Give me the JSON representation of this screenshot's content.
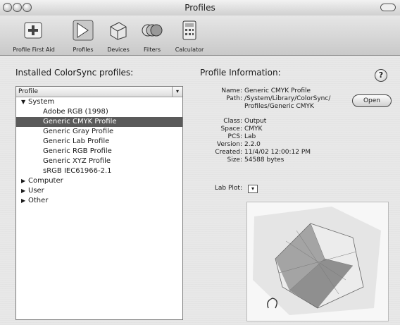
{
  "window": {
    "title": "Profiles"
  },
  "toolbar": {
    "items": [
      {
        "label": "Profile First Aid",
        "icon": "first-aid-icon"
      },
      {
        "label": "Profiles",
        "icon": "profiles-icon"
      },
      {
        "label": "Devices",
        "icon": "devices-icon"
      },
      {
        "label": "Filters",
        "icon": "filters-icon"
      },
      {
        "label": "Calculator",
        "icon": "calculator-icon"
      }
    ]
  },
  "left": {
    "label": "Installed ColorSync profiles:",
    "column_header": "Profile",
    "rows": [
      {
        "text": "System",
        "level": 0,
        "expanded": true
      },
      {
        "text": "Adobe RGB (1998)",
        "level": 1
      },
      {
        "text": "Generic CMYK Profile",
        "level": 1,
        "selected": true
      },
      {
        "text": "Generic Gray Profile",
        "level": 1
      },
      {
        "text": "Generic Lab Profile",
        "level": 1
      },
      {
        "text": "Generic RGB Profile",
        "level": 1
      },
      {
        "text": "Generic XYZ Profile",
        "level": 1
      },
      {
        "text": "sRGB IEC61966-2.1",
        "level": 1
      },
      {
        "text": "Computer",
        "level": 0,
        "expanded": false
      },
      {
        "text": "User",
        "level": 0,
        "expanded": false
      },
      {
        "text": "Other",
        "level": 0,
        "expanded": false
      }
    ]
  },
  "info": {
    "title": "Profile Information:",
    "help": "?",
    "fields": {
      "name_label": "Name:",
      "name": "Generic CMYK Profile",
      "path_label": "Path:",
      "path_line1": "/System/Library/ColorSync/",
      "path_line2": "Profiles/Generic CMYK",
      "class_label": "Class:",
      "class": "Output",
      "space_label": "Space:",
      "space": "CMYK",
      "pcs_label": "PCS:",
      "pcs": "Lab",
      "version_label": "Version:",
      "version": "2.2.0",
      "created_label": "Created:",
      "created": "11/4/02 12:00:12 PM",
      "size_label": "Size:",
      "size": "54588 bytes",
      "lab_plot_label": "Lab Plot:"
    },
    "open_button": "Open"
  }
}
